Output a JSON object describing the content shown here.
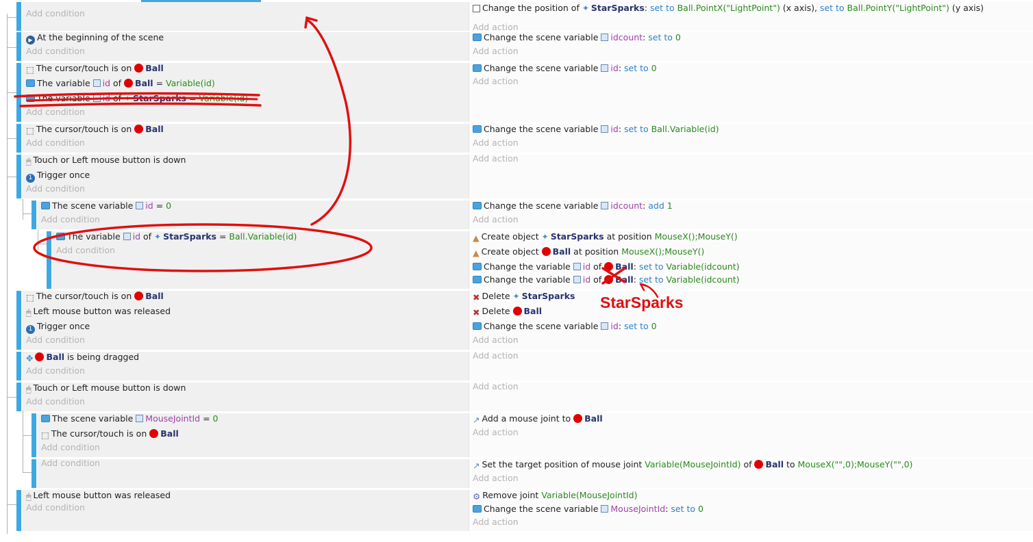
{
  "common": {
    "add_condition": "Add condition",
    "add_action": "Add action"
  },
  "events": [
    {
      "conds": [],
      "acts": [
        {
          "icon": "position-icon",
          "parts": [
            [
              "t",
              "Change the position of "
            ],
            [
              "spark",
              ""
            ],
            [
              "obj",
              "StarSparks"
            ],
            [
              "t",
              ": "
            ],
            [
              "op",
              "set to "
            ],
            [
              "val",
              "Ball.PointX(\"LightPoint\")"
            ],
            [
              "t",
              " (x axis), "
            ],
            [
              "op",
              "set to "
            ],
            [
              "val",
              "Ball.PointY(\"LightPoint\")"
            ],
            [
              "t",
              " (y axis)"
            ]
          ]
        }
      ]
    },
    {
      "conds": [
        {
          "icon": "scene-start-icon",
          "parts": [
            [
              "t",
              "At the beginning of the scene"
            ]
          ]
        }
      ],
      "acts": [
        {
          "icon": "variable-icon",
          "parts": [
            [
              "t",
              "Change the scene variable "
            ],
            [
              "pv",
              ""
            ],
            [
              "var",
              "idcount"
            ],
            [
              "t",
              ": "
            ],
            [
              "op",
              "set to "
            ],
            [
              "val",
              "0"
            ]
          ]
        }
      ]
    },
    {
      "conds": [
        {
          "icon": "cursor-on-object-icon",
          "parts": [
            [
              "t",
              "The cursor/touch is on "
            ],
            [
              "ball",
              ""
            ],
            [
              "obj",
              "Ball"
            ]
          ]
        },
        {
          "icon": "variable-icon",
          "parts": [
            [
              "t",
              "The variable "
            ],
            [
              "pv",
              ""
            ],
            [
              "var",
              "id"
            ],
            [
              "t",
              " of "
            ],
            [
              "ball",
              ""
            ],
            [
              "obj",
              "Ball"
            ],
            [
              "t",
              " = "
            ],
            [
              "val",
              "Variable(id)"
            ]
          ]
        },
        {
          "icon": "variable-icon",
          "parts": [
            [
              "t",
              "The variable "
            ],
            [
              "pv",
              ""
            ],
            [
              "var",
              "id"
            ],
            [
              "t",
              " of "
            ],
            [
              "spark",
              ""
            ],
            [
              "obj",
              "StarSparks"
            ],
            [
              "t",
              " = "
            ],
            [
              "val",
              "Variable(id)"
            ]
          ]
        }
      ],
      "acts": [
        {
          "icon": "variable-icon",
          "parts": [
            [
              "t",
              "Change the scene variable "
            ],
            [
              "pv",
              ""
            ],
            [
              "var",
              "id"
            ],
            [
              "t",
              ": "
            ],
            [
              "op",
              "set to "
            ],
            [
              "val",
              "0"
            ]
          ]
        }
      ]
    },
    {
      "conds": [
        {
          "icon": "cursor-on-object-icon",
          "parts": [
            [
              "t",
              "The cursor/touch is on "
            ],
            [
              "ball",
              ""
            ],
            [
              "obj",
              "Ball"
            ]
          ]
        }
      ],
      "acts": [
        {
          "icon": "variable-icon",
          "parts": [
            [
              "t",
              "Change the scene variable "
            ],
            [
              "pv",
              ""
            ],
            [
              "var",
              "id"
            ],
            [
              "t",
              ": "
            ],
            [
              "op",
              "set to "
            ],
            [
              "val",
              "Ball.Variable(id)"
            ]
          ]
        }
      ]
    },
    {
      "conds": [
        {
          "icon": "mouse-icon",
          "parts": [
            [
              "t",
              "Touch or "
            ],
            [
              "t",
              "Left"
            ],
            [
              "t",
              " mouse button is down"
            ]
          ]
        },
        {
          "icon": "trigger-once-icon",
          "parts": [
            [
              "t",
              "Trigger once"
            ]
          ]
        }
      ],
      "acts": []
    },
    {
      "conds": [
        {
          "icon": "variable-icon",
          "parts": [
            [
              "t",
              "The scene variable "
            ],
            [
              "pv",
              ""
            ],
            [
              "var",
              "id"
            ],
            [
              "t",
              " = "
            ],
            [
              "val",
              "0"
            ]
          ]
        }
      ],
      "acts": [
        {
          "icon": "variable-icon",
          "parts": [
            [
              "t",
              "Change the scene variable "
            ],
            [
              "pv",
              ""
            ],
            [
              "var",
              "idcount"
            ],
            [
              "t",
              ": "
            ],
            [
              "op",
              "add "
            ],
            [
              "val",
              "1"
            ]
          ]
        }
      ]
    },
    {
      "conds": [
        {
          "icon": "variable-icon",
          "parts": [
            [
              "t",
              "The variable "
            ],
            [
              "pv",
              ""
            ],
            [
              "var",
              "id"
            ],
            [
              "t",
              " of "
            ],
            [
              "spark",
              ""
            ],
            [
              "obj",
              "StarSparks"
            ],
            [
              "t",
              " = "
            ],
            [
              "val",
              "Ball.Variable(id)"
            ]
          ]
        }
      ],
      "acts": [
        {
          "icon": "create-object-icon",
          "parts": [
            [
              "t",
              "Create object "
            ],
            [
              "spark",
              ""
            ],
            [
              "obj",
              "StarSparks"
            ],
            [
              "t",
              " at position "
            ],
            [
              "val",
              "MouseX();MouseY()"
            ]
          ]
        },
        {
          "icon": "create-object-icon",
          "parts": [
            [
              "t",
              "Create object "
            ],
            [
              "ball",
              ""
            ],
            [
              "obj",
              "Ball"
            ],
            [
              "t",
              " at position "
            ],
            [
              "val",
              "MouseX();MouseY()"
            ]
          ]
        },
        {
          "icon": "variable-icon",
          "parts": [
            [
              "t",
              "Change the variable "
            ],
            [
              "pv",
              ""
            ],
            [
              "var",
              "id"
            ],
            [
              "t",
              " of "
            ],
            [
              "ball",
              ""
            ],
            [
              "obj",
              "Ball"
            ],
            [
              "t",
              ": "
            ],
            [
              "op",
              "set to "
            ],
            [
              "val",
              "Variable(idcount)"
            ]
          ]
        },
        {
          "icon": "variable-icon",
          "parts": [
            [
              "t",
              "Change the variable "
            ],
            [
              "pv",
              ""
            ],
            [
              "var",
              "id"
            ],
            [
              "t",
              " of "
            ],
            [
              "ball",
              ""
            ],
            [
              "obj",
              "Ball"
            ],
            [
              "t",
              ": "
            ],
            [
              "op",
              "set to "
            ],
            [
              "val",
              "Variable(idcount)"
            ]
          ]
        }
      ]
    },
    {
      "conds": [
        {
          "icon": "cursor-on-object-icon",
          "parts": [
            [
              "t",
              "The cursor/touch is on "
            ],
            [
              "ball",
              ""
            ],
            [
              "obj",
              "Ball"
            ]
          ]
        },
        {
          "icon": "mouse-icon",
          "parts": [
            [
              "t",
              "Left mouse button was released"
            ]
          ]
        },
        {
          "icon": "trigger-once-icon",
          "parts": [
            [
              "t",
              "Trigger once"
            ]
          ]
        }
      ],
      "acts": [
        {
          "icon": "delete-icon",
          "parts": [
            [
              "t",
              "Delete "
            ],
            [
              "spark",
              ""
            ],
            [
              "obj",
              "StarSparks"
            ]
          ]
        },
        {
          "icon": "delete-icon",
          "parts": [
            [
              "t",
              "Delete "
            ],
            [
              "ball",
              ""
            ],
            [
              "obj",
              "Ball"
            ]
          ]
        },
        {
          "icon": "variable-icon",
          "parts": [
            [
              "t",
              "Change the scene variable "
            ],
            [
              "pv",
              ""
            ],
            [
              "var",
              "id"
            ],
            [
              "t",
              ": "
            ],
            [
              "op",
              "set to "
            ],
            [
              "val",
              "0"
            ]
          ]
        }
      ]
    },
    {
      "conds": [
        {
          "icon": "drag-icon",
          "parts": [
            [
              "ball",
              ""
            ],
            [
              "obj",
              "Ball"
            ],
            [
              "t",
              " is being dragged"
            ]
          ]
        }
      ],
      "acts": []
    },
    {
      "conds": [
        {
          "icon": "mouse-icon",
          "parts": [
            [
              "t",
              "Touch or "
            ],
            [
              "t",
              "Left"
            ],
            [
              "t",
              " mouse button is down"
            ]
          ]
        }
      ],
      "acts": []
    },
    {
      "conds": [
        {
          "icon": "variable-icon",
          "parts": [
            [
              "t",
              "The scene variable "
            ],
            [
              "pv",
              ""
            ],
            [
              "var",
              "MouseJointId"
            ],
            [
              "t",
              " = "
            ],
            [
              "val",
              "0"
            ]
          ]
        },
        {
          "icon": "cursor-on-object-icon",
          "parts": [
            [
              "t",
              "The cursor/touch is on "
            ],
            [
              "ball",
              ""
            ],
            [
              "obj",
              "Ball"
            ]
          ]
        }
      ],
      "acts": [
        {
          "icon": "joint-icon",
          "parts": [
            [
              "t",
              "Add a mouse joint to "
            ],
            [
              "ball",
              ""
            ],
            [
              "obj",
              "Ball"
            ]
          ]
        }
      ]
    },
    {
      "conds": [],
      "acts": [
        {
          "icon": "joint-icon",
          "parts": [
            [
              "t",
              "Set the target position of mouse joint "
            ],
            [
              "val",
              "Variable(MouseJointId)"
            ],
            [
              "t",
              " of "
            ],
            [
              "ball",
              ""
            ],
            [
              "obj",
              "Ball"
            ],
            [
              "t",
              " to "
            ],
            [
              "val",
              "MouseX(\"\",0);MouseY(\"\",0)"
            ]
          ]
        }
      ]
    },
    {
      "conds": [
        {
          "icon": "mouse-icon",
          "parts": [
            [
              "t",
              "Left mouse button was released"
            ]
          ]
        }
      ],
      "acts": [
        {
          "icon": "gear-icon",
          "parts": [
            [
              "t",
              "Remove joint "
            ],
            [
              "val",
              "Variable(MouseJointId)"
            ]
          ]
        },
        {
          "icon": "variable-icon",
          "parts": [
            [
              "t",
              "Change the scene variable "
            ],
            [
              "pv",
              ""
            ],
            [
              "var",
              "MouseJointId"
            ],
            [
              "t",
              ": "
            ],
            [
              "op",
              "set to "
            ],
            [
              "val",
              "0"
            ]
          ]
        }
      ]
    }
  ],
  "annotation": {
    "label": "StarSparks",
    "color": "#e01010"
  }
}
